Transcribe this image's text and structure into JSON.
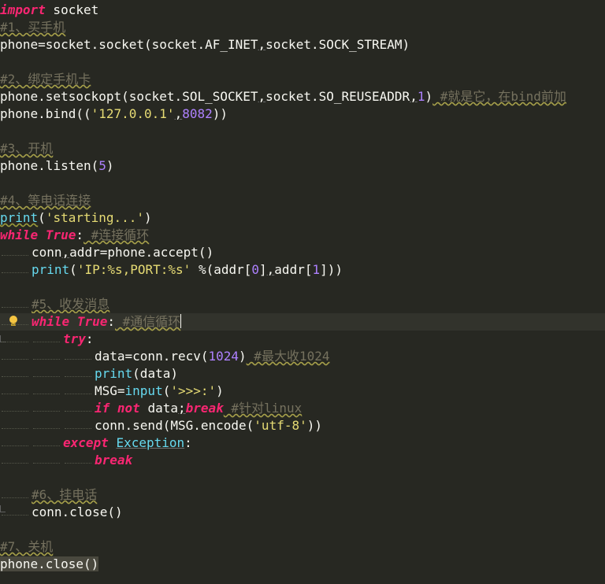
{
  "code": {
    "l1": {
      "kw_import": "import",
      "rest": " socket"
    },
    "l2": {
      "comment": "#1、买手机"
    },
    "l3": {
      "a": "phone=socket.socket(socket.AF_INET",
      "comma": ",",
      "b": "socket.SOCK_STREAM)"
    },
    "l5": {
      "comment": "#2、绑定手机卡"
    },
    "l6": {
      "a": "phone.setsockopt(socket.SOL_SOCKET",
      "comma1": ",",
      "b": "socket.SO_REUSEADDR",
      "comma2": ",",
      "num": "1",
      "close": ")",
      "comment": " #就是它，在bind前加"
    },
    "l7": {
      "a": "phone.bind((",
      "str": "'127.0.0.1'",
      "comma": ",",
      "num": "8082",
      "close": "))"
    },
    "l9": {
      "comment": "#3、开机"
    },
    "l10": {
      "a": "phone.listen(",
      "num": "5",
      "close": ")"
    },
    "l12": {
      "comment": "#4、等电话连接"
    },
    "l13": {
      "fn": "print",
      "open": "(",
      "str": "'starting...'",
      "close": ")"
    },
    "l14": {
      "kw_while": "while",
      "sp": " ",
      "kw_true": "True",
      "colon": ":",
      "comment": " #连接循环"
    },
    "l15": {
      "a": "conn",
      "comma": ",",
      "b": "addr=phone.accept()"
    },
    "l16": {
      "fn": "print",
      "open": "(",
      "str": "'IP:%s,PORT:%s'",
      "mid": " %(addr[",
      "n0": "0",
      "mid2": "]",
      "comma": ",",
      "b": "addr[",
      "n1": "1",
      "close": "]))"
    },
    "l18": {
      "comment": "#5、收发消息"
    },
    "l19": {
      "kw_while": "while",
      "sp": " ",
      "kw_true": "True",
      "colon": ":",
      "comment": " #通信循环"
    },
    "l20": {
      "kw_try": "try",
      "colon": ":"
    },
    "l21": {
      "a": "data=conn.recv(",
      "num": "1024",
      "close": ")",
      "comment": " #最大收1024"
    },
    "l22": {
      "fn": "print",
      "rest": "(data)"
    },
    "l23": {
      "a": "MSG=",
      "fn": "input",
      "open": "(",
      "str": "'>>>:'",
      "close": ")"
    },
    "l24": {
      "kw_if": "if",
      "sp1": " ",
      "kw_not": "not",
      "a": " data",
      "semi": ";",
      "kw_break": "break",
      "comment": " #针对linux"
    },
    "l25": {
      "a": "conn.send(MSG.encode(",
      "str": "'utf-8'",
      "close": "))"
    },
    "l26": {
      "kw_except": "except",
      "sp": " ",
      "exc": "Exception",
      "colon": ":"
    },
    "l27": {
      "kw_break": "break"
    },
    "l29": {
      "comment": "#6、挂电话"
    },
    "l30": {
      "a": "conn.close()"
    },
    "l32": {
      "comment": "#7、关机"
    },
    "l33": {
      "a": "phone.close()"
    }
  },
  "icons": {
    "gutter": "lightbulb-icon"
  },
  "colors": {
    "background": "#272822",
    "keyword": "#f92672",
    "builtin": "#66d9ef",
    "string": "#e6db74",
    "number": "#ae81ff",
    "comment": "#75715e",
    "text": "#f8f8f2"
  }
}
